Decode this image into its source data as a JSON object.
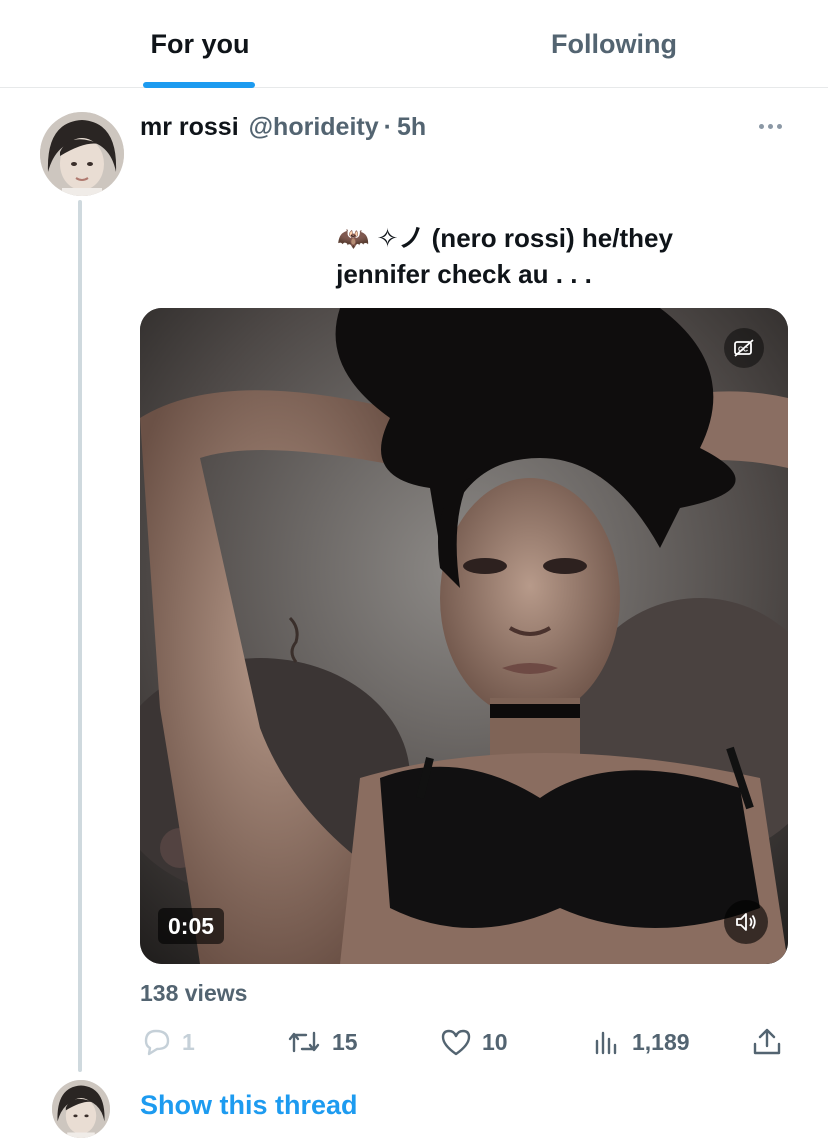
{
  "tabs": {
    "for_you": "For you",
    "following": "Following"
  },
  "post": {
    "display_name": "mr rossi",
    "handle": "@horideity",
    "separator": "·",
    "time": "5h",
    "text_line1": "🦇 ✧ノ  (nero rossi)  he/they",
    "text_line2": "jennifer check au . . .",
    "video": {
      "duration": "0:05",
      "cc_icon": "captions-off-icon",
      "volume_icon": "speaker-muted-icon"
    },
    "views_text": "138 views",
    "actions": {
      "replies": "1",
      "reposts": "15",
      "likes": "10",
      "views": "1,189"
    }
  },
  "show_thread": "Show this thread",
  "colors": {
    "accent": "#1d9bf0",
    "text_primary": "#0f1419",
    "text_secondary": "#536471",
    "divider": "#e7e9ea"
  }
}
